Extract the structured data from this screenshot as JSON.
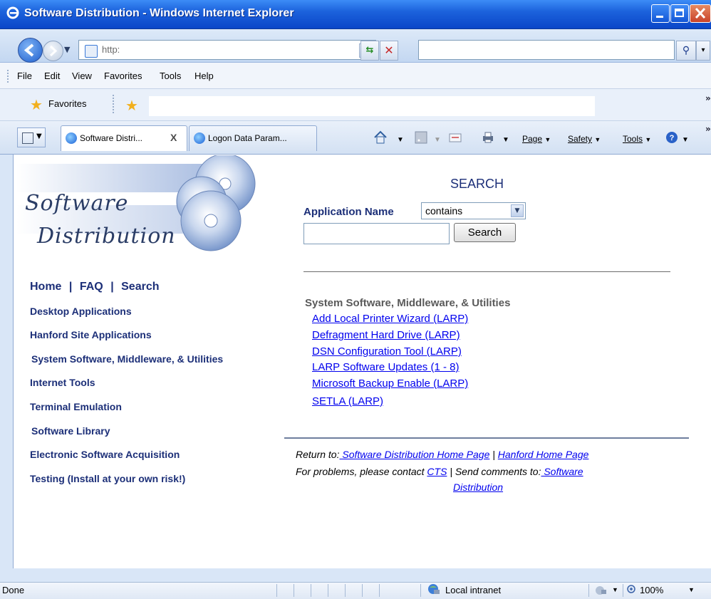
{
  "window": {
    "title": "Software Distribution - Windows Internet Explorer"
  },
  "address": {
    "url": "http:",
    "search_value": ""
  },
  "menu": [
    "File",
    "Edit",
    "View",
    "Favorites",
    "Tools",
    "Help"
  ],
  "favorites": {
    "label": "Favorites"
  },
  "tabs": [
    {
      "label": "Software Distri...",
      "close": "X"
    },
    {
      "label": "Logon Data Param..."
    }
  ],
  "commandbar": {
    "page": "Page",
    "safety": "Safety",
    "tools": "Tools"
  },
  "logo": {
    "line1": "Software",
    "line2": "Distribution"
  },
  "leftnav": {
    "home": "Home",
    "sep1": "|",
    "faq": "FAQ",
    "sep2": "|",
    "search": "Search",
    "items": [
      "Desktop Applications",
      "Hanford Site Applications",
      "System Software, Middleware, & Utilities",
      "Internet Tools",
      "Terminal Emulation",
      "Software Library",
      "Electronic Software Acquisition",
      "Testing (Install at your own risk!)"
    ]
  },
  "search": {
    "title": "SEARCH",
    "field_label": "Application Name",
    "operator": "contains",
    "input_value": "",
    "button": "Search"
  },
  "results": {
    "section_title": "System Software, Middleware, & Utilities",
    "links": [
      "Add Local Printer Wizard (LARP)",
      "Defragment Hard Drive (LARP)",
      "DSN Configuration Tool (LARP)",
      "LARP Software Updates (1 - 8)",
      "Microsoft Backup Enable (LARP)",
      "SETLA (LARP)"
    ]
  },
  "footer": {
    "return_to": "Return to:",
    "home_link": " Software Distribution Home Page",
    "sep": "|",
    "hanford_link": "Hanford Home Page",
    "problems": "For problems, please contact",
    "cts": "CTS",
    "comments": "| Send comments to:",
    "sd_link_1": " Software",
    "sd_link_2": "Distribution"
  },
  "status": {
    "text": "Done",
    "zone": "Local intranet",
    "zoom": "100%"
  },
  "colors": {
    "titlebar": "#1c62dc",
    "link": "#0000ee",
    "nav_text": "#1c2f78"
  }
}
